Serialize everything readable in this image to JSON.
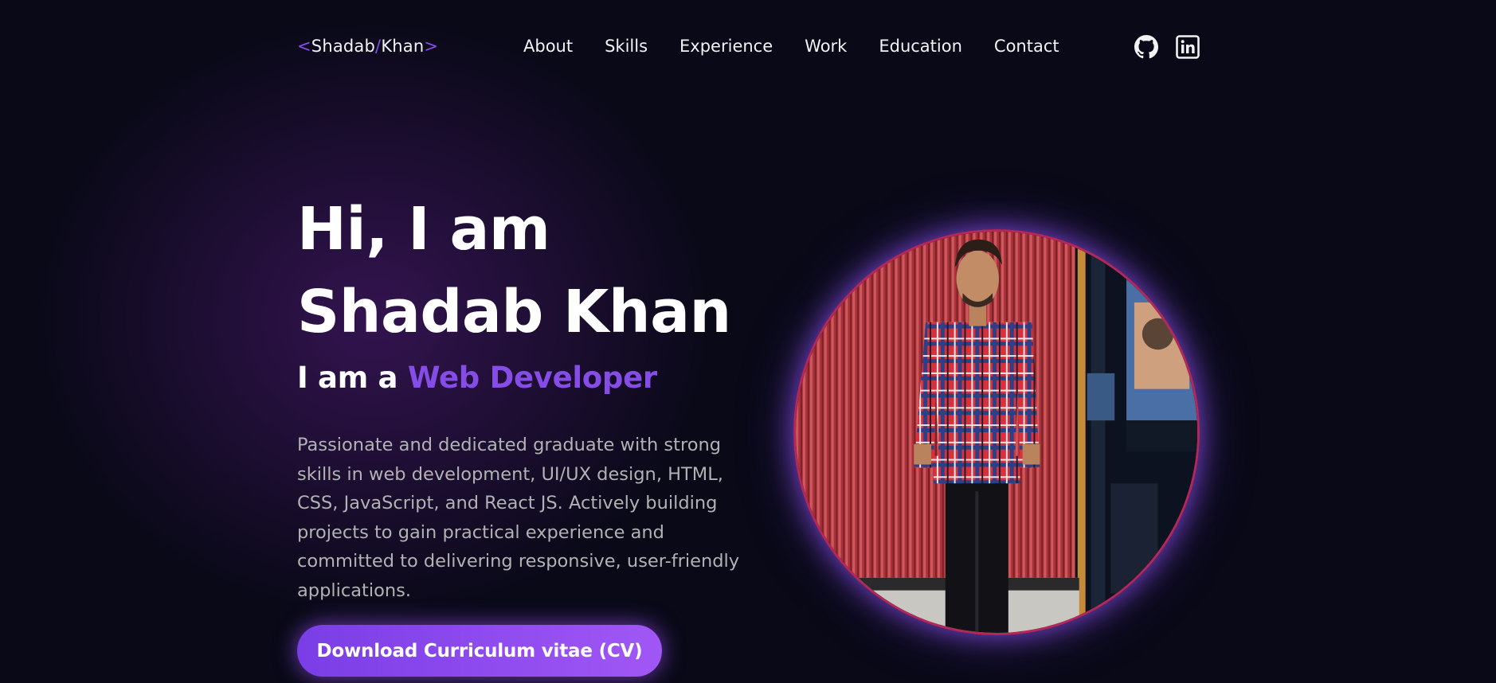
{
  "nav": {
    "logo": {
      "open": "<",
      "first": "Shadab",
      "slash": "/",
      "last": "Khan",
      "close": ">"
    },
    "links": [
      "About",
      "Skills",
      "Experience",
      "Work",
      "Education",
      "Contact"
    ],
    "social": [
      {
        "icon": "github-icon"
      },
      {
        "icon": "linkedin-icon"
      }
    ]
  },
  "hero": {
    "greeting": "Hi, I am",
    "name": "Shadab Khan",
    "role_prefix": "I am a",
    "role": "Web Developer",
    "description": "Passionate and dedicated graduate with strong skills in web development, UI/UX design, HTML, CSS, JavaScript, and React JS. Actively building projects to gain practical experience and committed to delivering responsive, user-friendly applications.",
    "cv_button": "Download Curriculum vitae (CV)"
  },
  "colors": {
    "background": "#090917",
    "accent": "#854ce6",
    "text": "#f2f3f4",
    "secondary_text": "#b1b2b3",
    "photo_border": "#b42759"
  }
}
